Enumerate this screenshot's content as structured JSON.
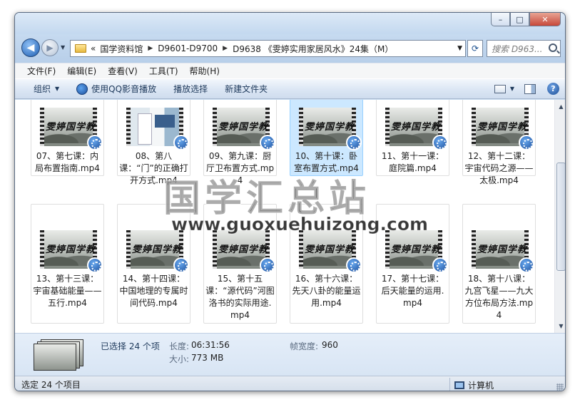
{
  "window": {
    "caption": {
      "minimize": "–",
      "maximize": "□",
      "close": "✕"
    }
  },
  "address": {
    "prefix": "«",
    "crumbs": [
      "国学资料馆",
      "D9601-D9700",
      "D9638 《雯婷实用家居风水》24集（M）"
    ],
    "search_placeholder": "搜索 D963..."
  },
  "menu": [
    "文件(F)",
    "编辑(E)",
    "查看(V)",
    "工具(T)",
    "帮助(H)"
  ],
  "toolbar": {
    "organize": "组织",
    "qq_play": "使用QQ影音播放",
    "playlist": "播放选择",
    "new_folder": "新建文件夹",
    "help": "?"
  },
  "thumb_caption": "雯婷国学教",
  "files": [
    {
      "label": "07、第七课：内局布置指南.mp4",
      "thumb": "logo",
      "selected": false
    },
    {
      "label": "08、第八课：“门”的正确打开方式.mp4",
      "thumb": "room",
      "selected": false
    },
    {
      "label": "09、第九课：厨厅卫布置方式.mp4",
      "thumb": "logo",
      "selected": false
    },
    {
      "label": "10、第十课：卧室布置方式.mp4",
      "thumb": "logo",
      "selected": true
    },
    {
      "label": "11、第十一课：庭院篇.mp4",
      "thumb": "logo",
      "selected": false
    },
    {
      "label": "12、第十二课：宇宙代码之源——太极.mp4",
      "thumb": "logo",
      "selected": false
    },
    {
      "label": "13、第十三课：宇宙基础能量——五行.mp4",
      "thumb": "logo",
      "selected": false
    },
    {
      "label": "14、第十四课：中国地理的专属时间代码.mp4",
      "thumb": "logo",
      "selected": false
    },
    {
      "label": "15、第十五课：“源代码”河图洛书的实际用途.mp4",
      "thumb": "logo",
      "selected": false
    },
    {
      "label": "16、第十六课：先天八卦的能量运用.mp4",
      "thumb": "logo",
      "selected": false
    },
    {
      "label": "17、第十七课：后天能量的运用.mp4",
      "thumb": "logo",
      "selected": false
    },
    {
      "label": "18、第十八课：九宫飞星——九大方位布局方法.mp4",
      "thumb": "logo",
      "selected": false
    }
  ],
  "watermark": {
    "line1": "国学汇总站",
    "line2": "www.guoxuehuizong.com"
  },
  "details": {
    "title": "已选择 24 个项",
    "length_label": "长度:",
    "length_value": "06:31:56",
    "size_label": "大小:",
    "size_value": "773 MB",
    "framewidth_label": "帧宽度:",
    "framewidth_value": "960"
  },
  "status": {
    "left": "选定 24 个项目",
    "right": "计算机"
  }
}
